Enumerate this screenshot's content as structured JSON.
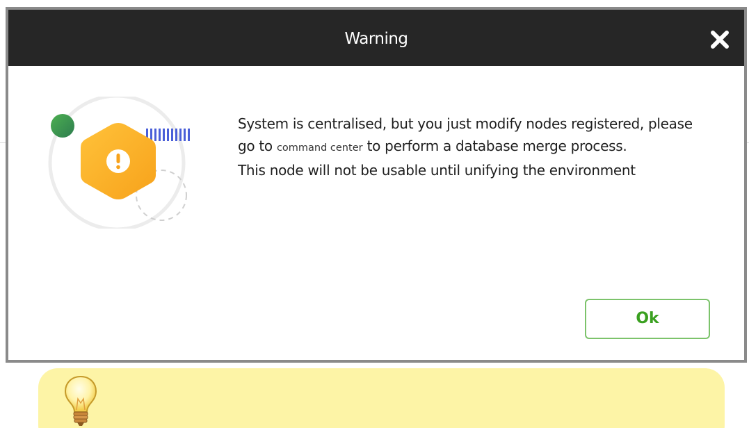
{
  "dialog": {
    "title": "Warning",
    "close_icon": "close-icon",
    "message": {
      "part1": "System is centralised, but you just modify nodes registered, please go to ",
      "link": "command center",
      "part2": " to perform a database merge process.",
      "line2": "This node will not be usable until unifying the environment"
    },
    "ok_label": "Ok",
    "illustration_icon": "warning-hexagon-icon"
  },
  "tip": {
    "icon": "lightbulb-icon"
  },
  "colors": {
    "header_bg": "#262626",
    "accent_green": "#7cc36b",
    "ok_text": "#3aa020",
    "warning_orange": "#fbb02c",
    "tip_bg": "#fdf4a6"
  }
}
